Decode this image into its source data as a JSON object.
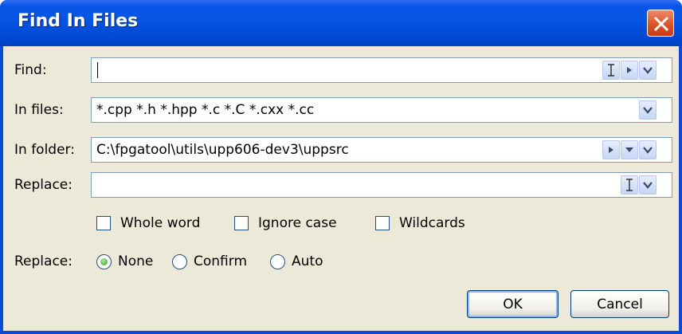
{
  "window": {
    "title": "Find In Files"
  },
  "labels": {
    "find": "Find:",
    "in_files": "In files:",
    "in_folder": "In folder:",
    "replace": "Replace:",
    "replace_mode": "Replace:"
  },
  "fields": {
    "find_value": "",
    "in_files_value": "*.cpp *.h *.hpp *.c *.C *.cxx *.cc",
    "in_folder_value": "C:\\fpgatool\\utils\\upp606-dev3\\uppsrc",
    "replace_value": ""
  },
  "options": {
    "whole_word": "Whole word",
    "ignore_case": "Ignore case",
    "wildcards": "Wildcards",
    "whole_word_checked": false,
    "ignore_case_checked": false,
    "wildcards_checked": false
  },
  "replace_mode": {
    "none": "None",
    "confirm": "Confirm",
    "auto": "Auto",
    "selected": "None"
  },
  "buttons": {
    "ok": "OK",
    "cancel": "Cancel"
  },
  "colors": {
    "title_bar": "#0054e3",
    "dialog_bg": "#ece9d8",
    "field_border": "#7f9db9",
    "close_red": "#d9532a"
  },
  "icons": [
    "close-icon",
    "text-cursor-icon",
    "play-arrow-icon",
    "dropdown-arrow-icon"
  ]
}
